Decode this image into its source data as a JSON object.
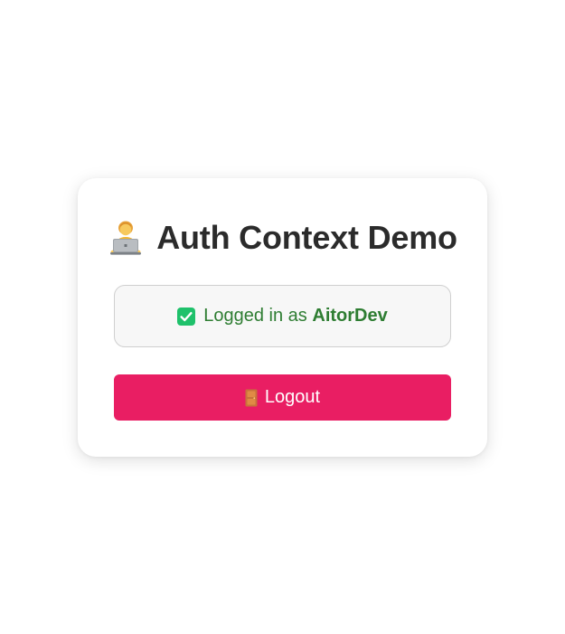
{
  "card": {
    "title": "Auth Context Demo",
    "title_icon": "technologist-icon"
  },
  "status": {
    "icon": "check-mark-button-icon",
    "prefix": "Logged in as",
    "username": "AitorDev",
    "color": "#2e7d32"
  },
  "logout": {
    "icon": "door-icon",
    "label": "Logout",
    "color": "#e91e63"
  }
}
